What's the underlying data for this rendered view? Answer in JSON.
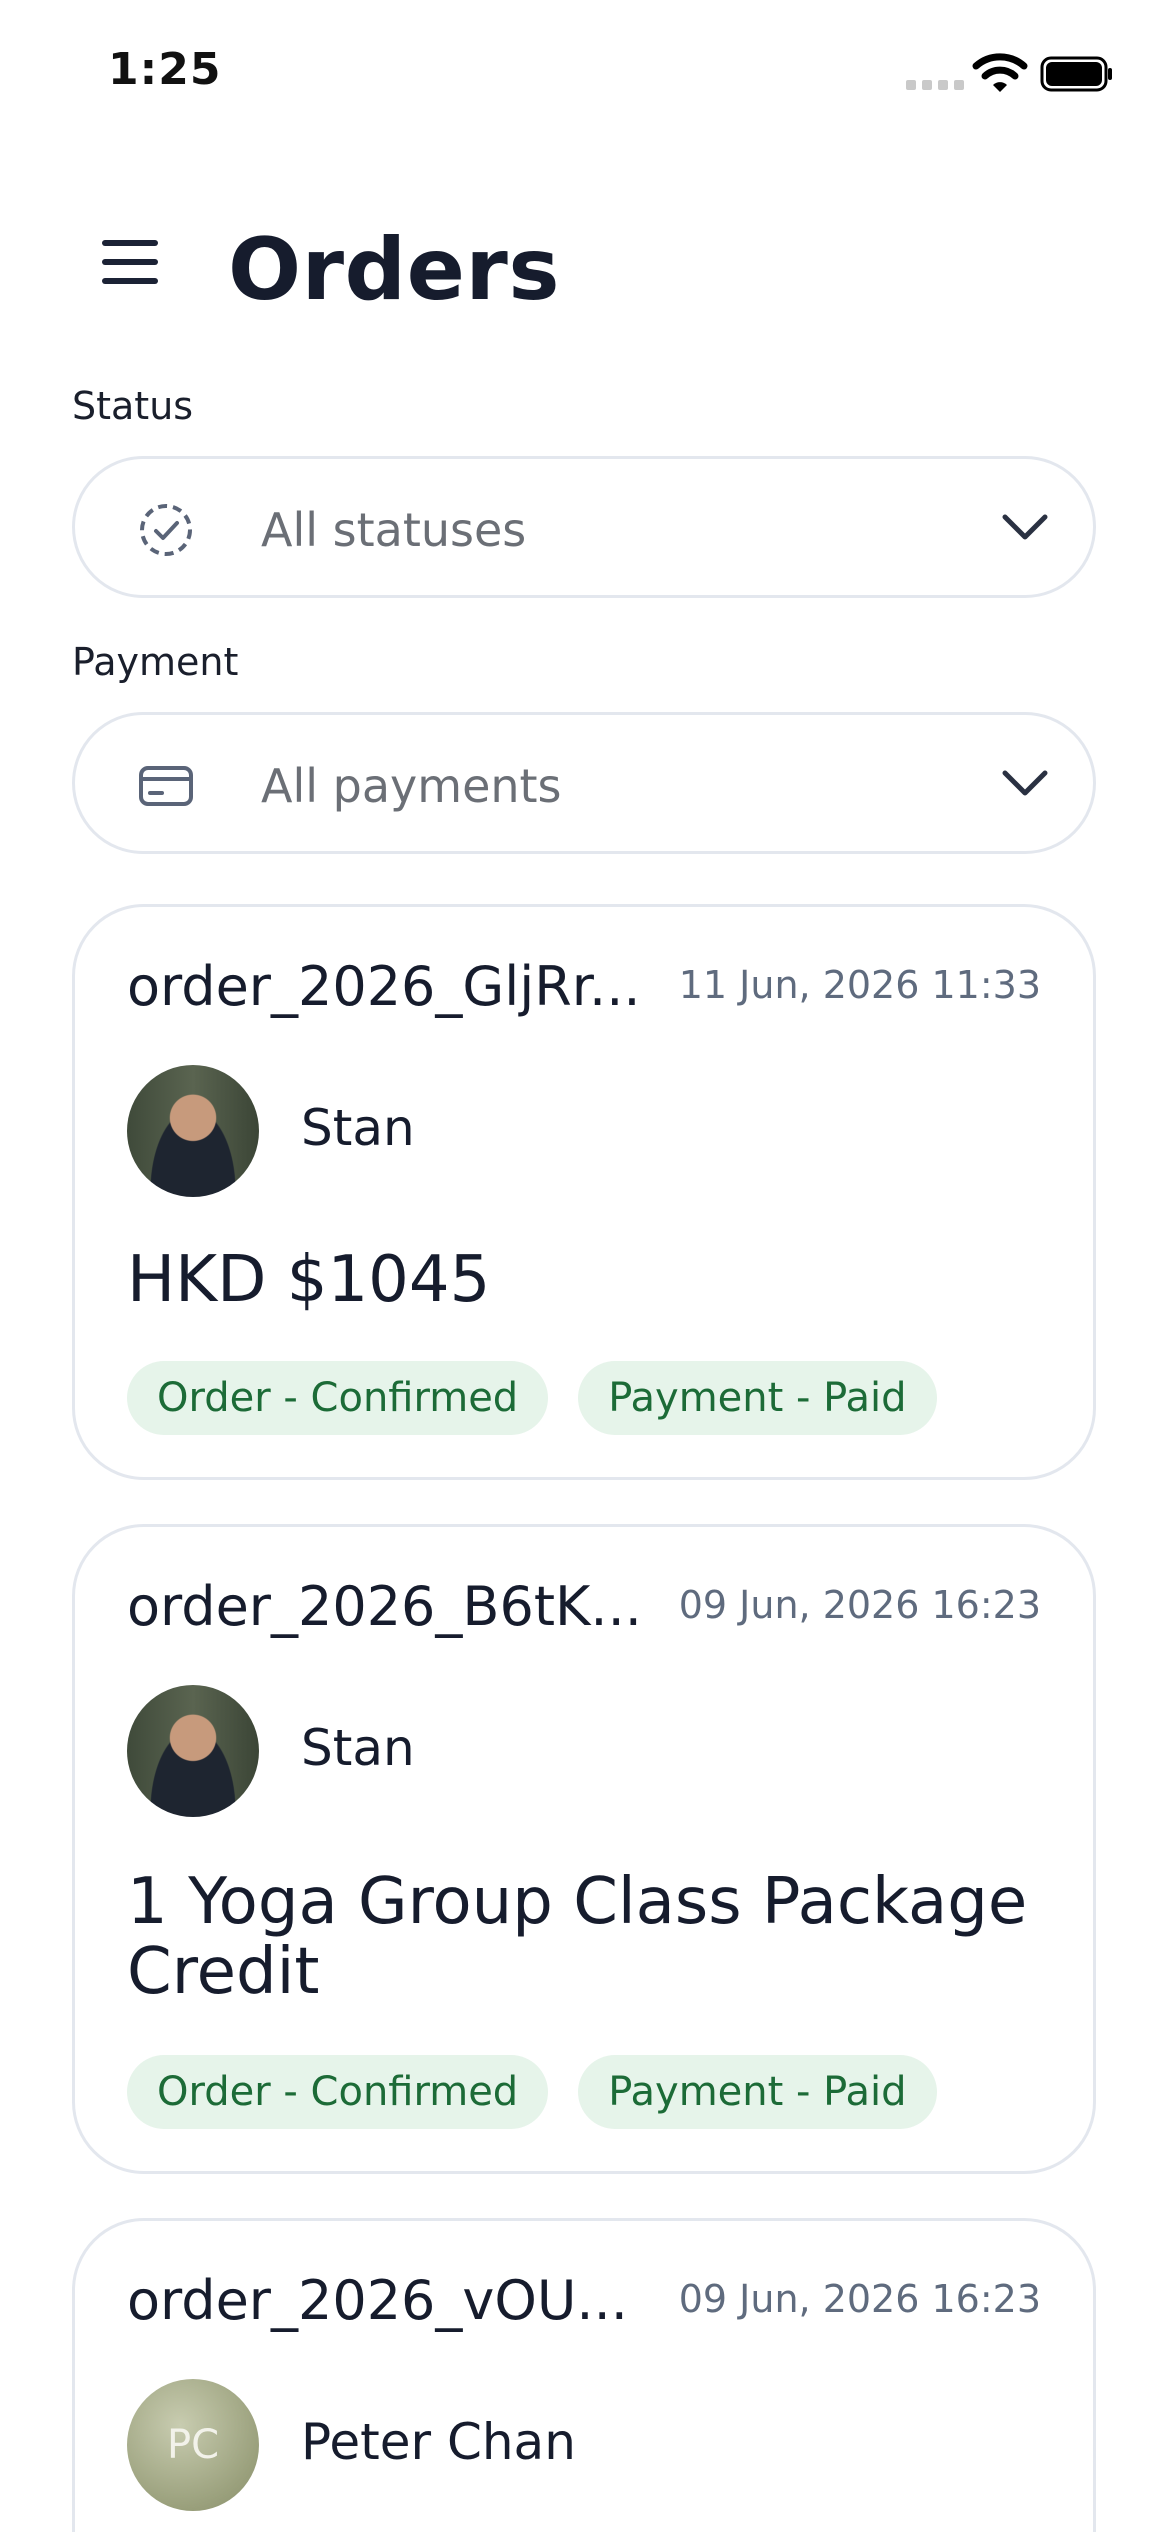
{
  "status_bar": {
    "time": "1:25"
  },
  "header": {
    "title": "Orders"
  },
  "filters": {
    "status": {
      "label": "Status",
      "value": "All statuses"
    },
    "payment": {
      "label": "Payment",
      "value": "All payments"
    }
  },
  "orders": [
    {
      "id": "order_2026_GljRr...",
      "date": "11 Jun, 2026 11:33",
      "customer": "Stan",
      "title": "HKD $1045",
      "order_status": "Order - Confirmed",
      "payment_status": "Payment - Paid"
    },
    {
      "id": "order_2026_B6tK...",
      "date": "09 Jun, 2026 16:23",
      "customer": "Stan",
      "title": "1 Yoga Group Class Package Credit",
      "order_status": "Order - Confirmed",
      "payment_status": "Payment - Paid"
    },
    {
      "id": "order_2026_vOU...",
      "date": "09 Jun, 2026 16:23",
      "customer": "Peter Chan",
      "initials": "PC"
    }
  ],
  "colors": {
    "badge_bg": "#e6f4ea",
    "badge_text": "#1c6b37",
    "title": "#161c2d",
    "border": "#e3e7ee"
  }
}
